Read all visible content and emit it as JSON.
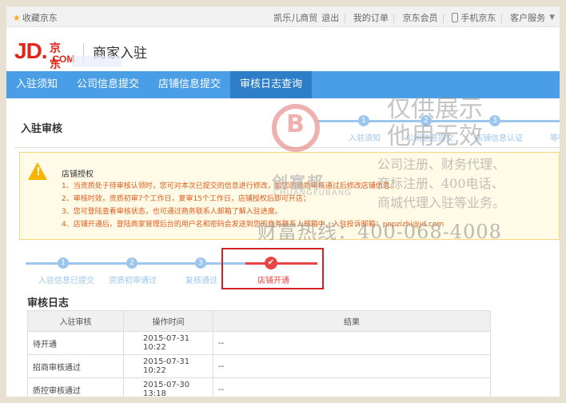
{
  "topbar": {
    "favorite": "收藏京东",
    "links": [
      "凯乐儿商贸",
      "退出",
      "我的订单",
      "京东会员",
      "手机京东",
      "客户服务"
    ]
  },
  "logo": {
    "jd": "JD.",
    "cn": "京东",
    "com": ".COM",
    "title": "商家入驻"
  },
  "nav": {
    "items": [
      "入驻须知",
      "公司信息提交",
      "店铺信息提交",
      "审核日志查询"
    ],
    "active": 3
  },
  "panel": {
    "title": "入驻审核"
  },
  "top_steps": [
    {
      "num": "1",
      "label": "入驻须知"
    },
    {
      "num": "2",
      "label": "公司信息提交"
    },
    {
      "num": "3",
      "label": "店铺信息认证"
    },
    {
      "num": "",
      "label": "等待"
    }
  ],
  "notice": {
    "title": "店铺授权",
    "lines": [
      "1、当资质处于待审核认领时，您可对本次已提交的信息进行修改，如您的资质审核通过后修改店铺信息。",
      "2、审核时效，资质初审7个工作日，复审15个工作日，店铺授权后即可开店；",
      "3、您可登陆查看审核状态，也可通过商务联系人邮箱了解入驻进度。",
      "4、店铺开通后，登陆商家管理后台的用户名和密码会发送到您的商务联系人邮箱中。入驻投诉邮箱：popzizhi@jd.com"
    ]
  },
  "steps": [
    {
      "num": "1",
      "label": "入驻信息已提交"
    },
    {
      "num": "2",
      "label": "资质初审通过"
    },
    {
      "num": "3",
      "label": "复核通过"
    },
    {
      "num": "✔",
      "label": "店铺开通"
    }
  ],
  "log": {
    "title": "审核日志",
    "headers": [
      "入驻审核",
      "操作时间",
      "结果"
    ],
    "rows": [
      [
        "待开通",
        "2015-07-31 10:22",
        "--"
      ],
      [
        "招商审核通过",
        "2015-07-31 10:22",
        "--"
      ],
      [
        "质控审核通过",
        "2015-07-30 13:18",
        "--"
      ]
    ]
  },
  "watermark": {
    "title_1": "仅供展示",
    "title_2": "他用无效",
    "sub_1": "公司注册、财务代理、",
    "sub_2": "商标注册、400电话、",
    "sub_3": "商城代理入驻等业务。",
    "brand": "创富邦",
    "brand_en": "CHUANGFUBANG",
    "hotline": "财富热线：400-068-4008"
  },
  "colors": {
    "nav": "#4a9ee6",
    "nav_active": "#2d7dc8",
    "jd_red": "#e1251b",
    "step": "#9cc6ee",
    "step_done": "#e64646"
  }
}
